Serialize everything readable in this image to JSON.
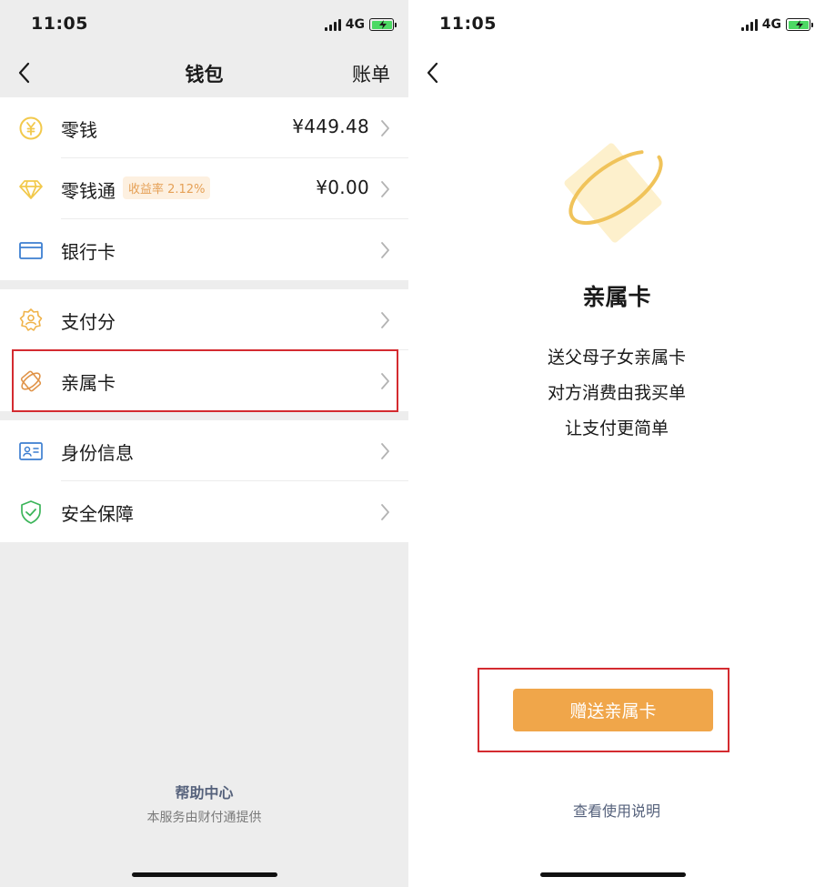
{
  "status": {
    "time": "11:05",
    "network": "4G"
  },
  "wallet": {
    "title": "钱包",
    "bill_link": "账单",
    "items": [
      {
        "label": "零钱",
        "value": "¥449.48",
        "icon": "yuan-coin-icon"
      },
      {
        "label": "零钱通",
        "value": "¥0.00",
        "badge": "收益率 2.12%",
        "icon": "diamond-icon"
      },
      {
        "label": "银行卡",
        "value": "",
        "icon": "bank-card-icon"
      },
      {
        "label": "支付分",
        "value": "",
        "icon": "pay-score-icon"
      },
      {
        "label": "亲属卡",
        "value": "",
        "icon": "family-card-icon"
      },
      {
        "label": "身份信息",
        "value": "",
        "icon": "id-card-icon"
      },
      {
        "label": "安全保障",
        "value": "",
        "icon": "security-shield-icon"
      }
    ],
    "help_center": "帮助中心",
    "provider_note": "本服务由财付通提供"
  },
  "family_card": {
    "title": "亲属卡",
    "lines": [
      "送父母子女亲属卡",
      "对方消费由我买单",
      "让支付更简单"
    ],
    "gift_button": "赠送亲属卡",
    "usage_link": "查看使用说明"
  },
  "colors": {
    "accent_orange": "#f0a64a",
    "highlight_red": "#d42b30",
    "link_blue": "#56627c",
    "coin_yellow": "#f2c94c"
  }
}
